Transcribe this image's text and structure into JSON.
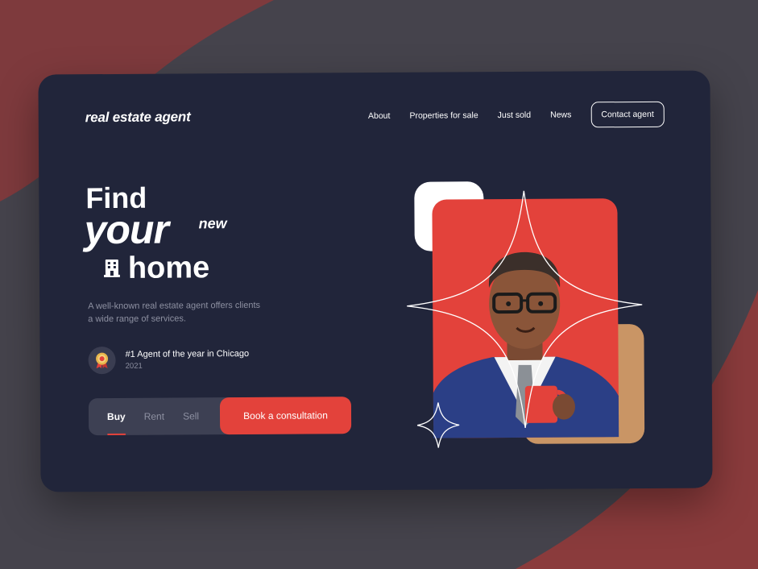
{
  "brand": {
    "logo_text": "real estate agent"
  },
  "nav": {
    "links": [
      "About",
      "Properties for sale",
      "Just sold",
      "News"
    ],
    "contact_label": "Contact agent"
  },
  "hero": {
    "line1": "Find",
    "line2": "your",
    "line2_suffix": "new",
    "line3": "home",
    "description": "A well-known real estate agent offers clients a wide range of services.",
    "icon": "building-icon"
  },
  "award": {
    "title": "#1 Agent of the year in Chicago",
    "year": "2021",
    "icon": "award-medal-icon"
  },
  "actions": {
    "tabs": [
      "Buy",
      "Rent",
      "Sell"
    ],
    "active_tab": "Buy",
    "cta_label": "Book a consultation"
  },
  "colors": {
    "page_bg": "#45434c",
    "bg_accent": "#8a3b3c",
    "card_bg": "#21253a",
    "accent_red": "#e3423b",
    "accent_tan": "#c99565",
    "muted_text": "#8d90a1"
  }
}
